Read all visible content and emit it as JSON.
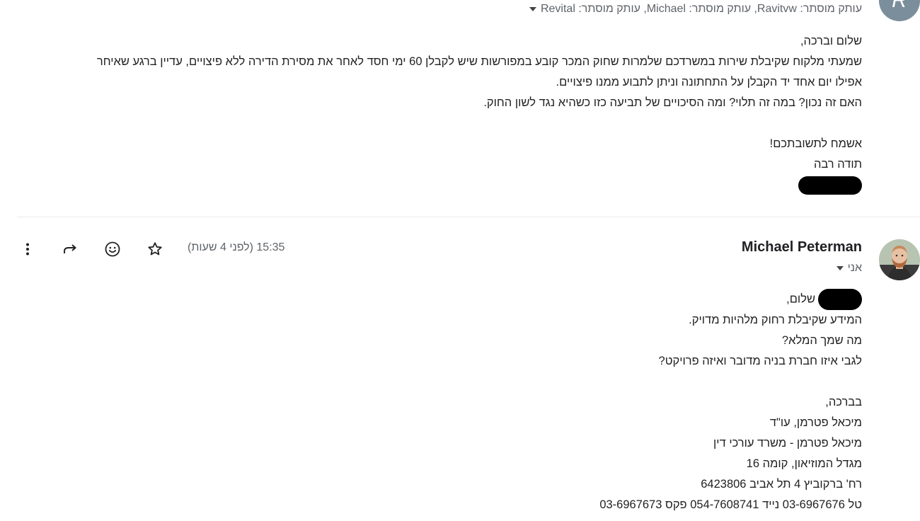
{
  "message1": {
    "avatar_letter": "R",
    "bcc_text": "עותק מוסתר: Ravitvw, עותק מוסתר: Michael, עותק מוסתר: Revital",
    "lines": [
      "שלום וברכה,",
      "שמעתי מלקוח שקיבלת שירות במשרדכם שלמרות שחוק המכר קובע במפורשות שיש לקבלן 60 ימי חסד לאחר את מסירת הדירה ללא פיצויים, עדיין ברגע שאיחר",
      "אפילו יום אחד יד הקבלן על התחתונה וניתן לתבוע ממנו פיצויים.",
      "האם זה נכון? במה זה תלוי? ומה הסיכויים של תביעה כזו כשהיא נגד לשון החוק."
    ],
    "closing": [
      "אשמח לתשובתכם!",
      "תודה רבה"
    ]
  },
  "message2": {
    "sender": "Michael Peterman",
    "to": "אני",
    "time": "15:35 (לפני 4 שעות)",
    "greeting": "שלום,",
    "lines": [
      "המידע שקיבלת רחוק מלהיות מדויק.",
      "מה שמך המלא?",
      "לגבי איזו חברת בניה מדובר ואיזה פרויקט?"
    ],
    "signature": [
      "בברכה,",
      "מיכאל פטרמן, עו\"ד",
      "מיכאל פטרמן - משרד עורכי דין",
      "מגדל המוזיאון, קומה 16",
      "רח' ברקוביץ 4 תל אביב 6423806",
      "טל 03-6967676 נייד 054-7608741 פקס 03-6967673"
    ]
  },
  "icons": {
    "more": "more-vert-icon",
    "forward": "forward-icon",
    "emoji": "emoji-icon",
    "star": "star-icon"
  }
}
